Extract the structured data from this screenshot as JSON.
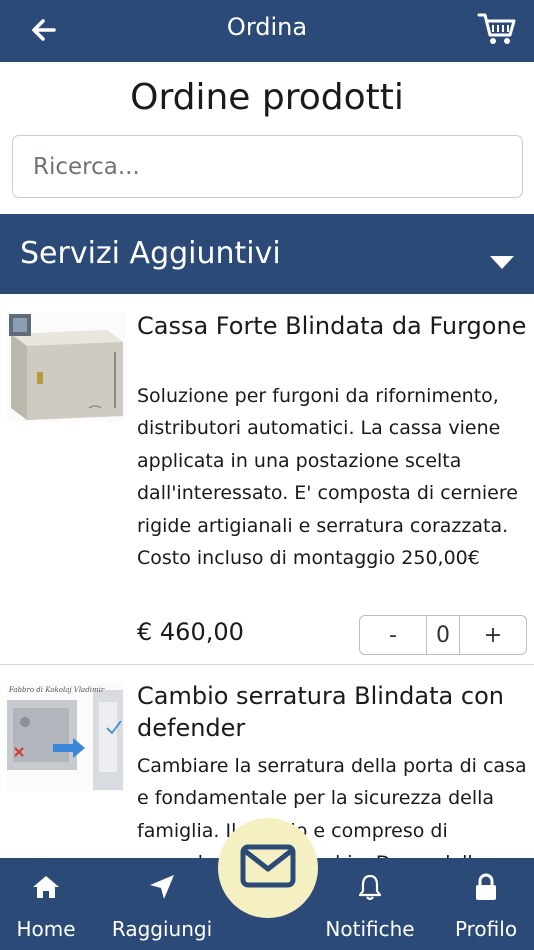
{
  "header": {
    "title": "Ordina",
    "back_icon": "arrow-left-icon",
    "cart_icon": "shopping-cart-icon"
  },
  "page_title": "Ordine prodotti",
  "search": {
    "placeholder": "Ricerca...",
    "value": ""
  },
  "section": {
    "label": "Servizi Aggiuntivi",
    "icon": "caret-down-icon"
  },
  "products": [
    {
      "name": "Cassa Forte Blindata da Furgone",
      "description": "Soluzione per furgoni da rifornimento, distributori automatici. La cassa viene applicata in una postazione scelta dall'interessato. E' composta di cerniere rigide artigianali e serratura corazzata. Costo incluso di montaggio 250,00€",
      "price": "€ 460,00",
      "quantity": "0",
      "minus": "-",
      "plus": "+"
    },
    {
      "name": "Cambio serratura Blindata con defender",
      "description": "Cambiare la serratura della porta di casa e fondamentale per la sicurezza della famiglia. Il sevizio e compreso di manodopera e ricambio. Da modello a"
    }
  ],
  "bottom_nav": {
    "items": [
      {
        "label": "Home",
        "icon": "home-icon"
      },
      {
        "label": "Raggiungi",
        "icon": "navigation-arrow-icon"
      },
      {
        "label": "Notifiche",
        "icon": "bell-icon"
      },
      {
        "label": "Profilo",
        "icon": "lock-icon"
      }
    ],
    "fab_icon": "envelope-icon"
  },
  "colors": {
    "primary": "#2c4a78",
    "fab": "#f5f0c2",
    "text": "#1a1a1a",
    "border": "#c9ccd1"
  }
}
